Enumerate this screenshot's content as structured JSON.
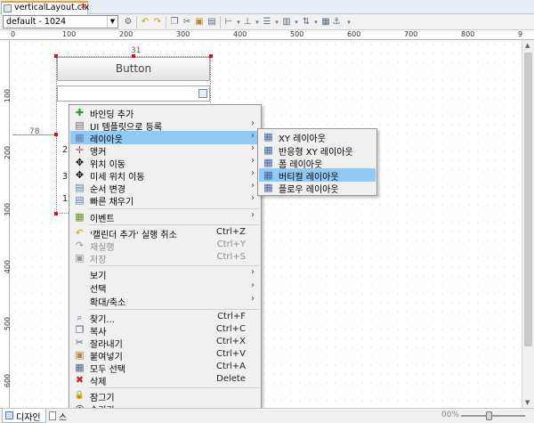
{
  "editor_tab": {
    "title": "verticalLayout.clx",
    "close": "✕"
  },
  "toolbar": {
    "device_combo": "default - 1024"
  },
  "rulers": {
    "horizontal": [
      "0",
      "100",
      "200",
      "300",
      "400",
      "500",
      "600",
      "700",
      "800",
      "9"
    ],
    "vertical": [
      "100",
      "200",
      "300",
      "400",
      "500",
      "600"
    ]
  },
  "canvas": {
    "button_label": "Button",
    "dim_top": "31",
    "dim_left": "78",
    "behind_rows": [
      "2",
      "3",
      "1"
    ]
  },
  "context_menu": {
    "items": [
      {
        "label": "바인딩 추가",
        "icon": "✚",
        "color": "#22a022",
        "shortcut": "",
        "arrow": ""
      },
      {
        "label": "UI 템플릿으로 등록",
        "icon": "▤",
        "color": "#6b6b6b",
        "shortcut": "",
        "arrow": "›"
      },
      {
        "label": "레이아웃",
        "icon": "▦",
        "color": "#6080b0",
        "shortcut": "",
        "arrow": "›"
      },
      {
        "label": "앵커",
        "icon": "✛",
        "color": "#b05050",
        "shortcut": "",
        "arrow": "›"
      },
      {
        "label": "위치 이동",
        "icon": "✥",
        "color": "#333333",
        "shortcut": "",
        "arrow": "›"
      },
      {
        "label": "미세 위치 이동",
        "icon": "✥",
        "color": "#333333",
        "shortcut": "",
        "arrow": "›"
      },
      {
        "label": "순서 변경",
        "icon": "▤",
        "color": "#6080b0",
        "shortcut": "",
        "arrow": "›"
      },
      {
        "label": "빠른 채우기",
        "icon": "▤",
        "color": "#6080b0",
        "shortcut": "",
        "arrow": "›"
      },
      {
        "label": "이벤트",
        "icon": "▦",
        "color": "#6b8e23",
        "shortcut": "",
        "arrow": "›"
      },
      {
        "label": "'캘린더 추가' 실행 취소",
        "icon": "↶",
        "color": "#c8a020",
        "shortcut": "Ctrl+Z",
        "arrow": ""
      },
      {
        "label": "재실행",
        "icon": "↷",
        "color": "#9a9a9a",
        "shortcut": "Ctrl+Y",
        "arrow": ""
      },
      {
        "label": "저장",
        "icon": "▣",
        "color": "#9a9a9a",
        "shortcut": "Ctrl+S",
        "arrow": ""
      },
      {
        "label": "보기",
        "icon": "",
        "color": "#333333",
        "shortcut": "",
        "arrow": "›"
      },
      {
        "label": "선택",
        "icon": "",
        "color": "#333333",
        "shortcut": "",
        "arrow": "›"
      },
      {
        "label": "확대/축소",
        "icon": "",
        "color": "#333333",
        "shortcut": "",
        "arrow": "›"
      },
      {
        "label": "찾기...",
        "icon": "⌕",
        "color": "#506080",
        "shortcut": "Ctrl+F",
        "arrow": ""
      },
      {
        "label": "복사",
        "icon": "❐",
        "color": "#506080",
        "shortcut": "Ctrl+C",
        "arrow": ""
      },
      {
        "label": "잘라내기",
        "icon": "✂",
        "color": "#506080",
        "shortcut": "Ctrl+X",
        "arrow": ""
      },
      {
        "label": "붙여넣기",
        "icon": "▣",
        "color": "#b08a40",
        "shortcut": "Ctrl+V",
        "arrow": ""
      },
      {
        "label": "모두 선택",
        "icon": "▦",
        "color": "#506080",
        "shortcut": "Ctrl+A",
        "arrow": ""
      },
      {
        "label": "삭제",
        "icon": "✖",
        "color": "#d02020",
        "shortcut": "Delete",
        "arrow": ""
      },
      {
        "label": "잠그기",
        "icon": "🔒",
        "color": "#c89020",
        "shortcut": "",
        "arrow": ""
      },
      {
        "label": "숨기기",
        "icon": "◎",
        "color": "#333333",
        "shortcut": "",
        "arrow": ""
      }
    ]
  },
  "layout_submenu": {
    "items": [
      {
        "label": "XY 레이아웃",
        "icon": "▦",
        "color": "#4060a0"
      },
      {
        "label": "반응형 XY 레이아웃",
        "icon": "▦",
        "color": "#4060a0"
      },
      {
        "label": "폼 레이아웃",
        "icon": "▦",
        "color": "#4060a0"
      },
      {
        "label": "버티컬 레이아웃",
        "icon": "▦",
        "color": "#4060a0"
      },
      {
        "label": "플로우 레이아웃",
        "icon": "▦",
        "color": "#4060a0"
      }
    ]
  },
  "bottom": {
    "design_tab": "디자인",
    "source_tab": "스",
    "zoom": "00%"
  }
}
